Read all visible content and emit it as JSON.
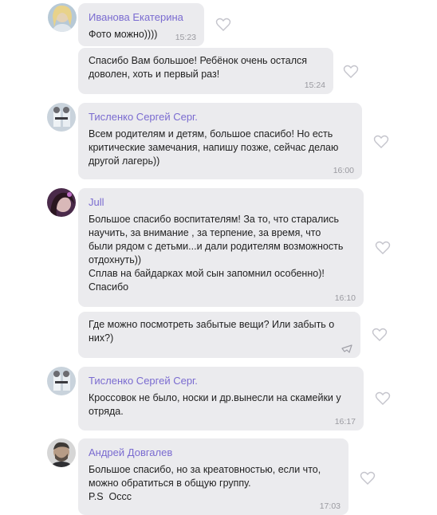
{
  "messages": [
    {
      "sender": "Иванова Екатерина",
      "text": "Фото можно))))",
      "time": "15:23"
    },
    {
      "sender": "",
      "text": "Спасибо Вам большое! Ребёнок очень остался\nдоволен, хоть и первый раз!",
      "time": "15:24"
    },
    {
      "sender": "Тисленко Сергей Серг.",
      "text": "Всем родителям и детям, большое спасибо! Но есть\nкритические замечания, напишу позже, сейчас делаю\nдругой лагерь))",
      "time": "16:00"
    },
    {
      "sender": "Jull",
      "text": "Большое спасибо воспитателям! За то, что старались\nнаучить, за внимание , за терпение, за время, что\nбыли рядом с детьми...и дали родителям возможность\nотдохнуть))\nСплав на байдарках мой сын запомнил особенно)!\nСпасибо",
      "time": "16:10"
    },
    {
      "sender": "",
      "text": "Где можно посмотреть забытые вещи? Или забыть о\nних?)",
      "time": ""
    },
    {
      "sender": "Тисленко Сергей Серг.",
      "text": "Кроссовок не было, носки и др.вынесли на скамейки у\nотряда.",
      "time": "16:17"
    },
    {
      "sender": "Андрей Довгалев",
      "text": "Большое спасибо, но за креатовностью, если что,\nможно обратиться в общую группу.\nP.S  Оссс",
      "time": "17:03"
    }
  ],
  "colors": {
    "bubble": "#ebebee",
    "sender": "#7a6bd0",
    "timestamp": "#9a9aa0",
    "heart": "#c4c4cc"
  },
  "icons": [
    "heart-icon",
    "sent-icon"
  ]
}
